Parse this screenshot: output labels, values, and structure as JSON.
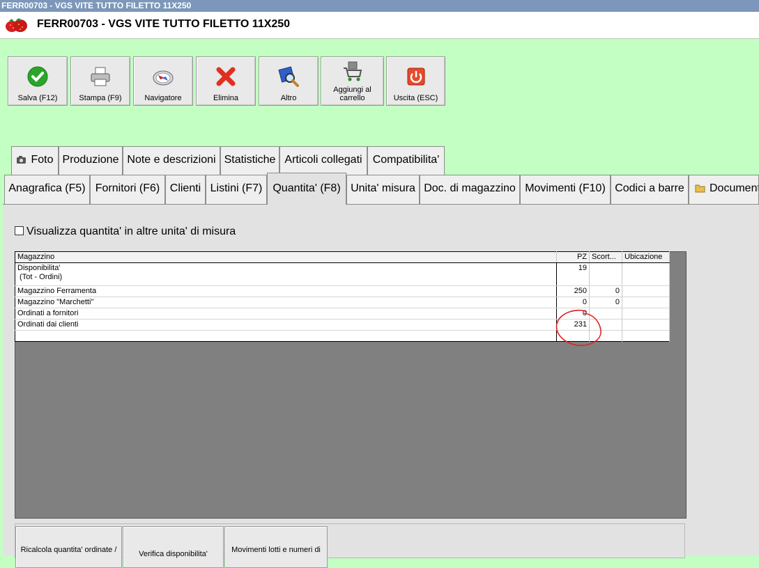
{
  "window": {
    "title": "FERR00703 - VGS VITE TUTTO FILETTO 11X250"
  },
  "header": {
    "title": "FERR00703 - VGS VITE TUTTO FILETTO 11X250",
    "logo": "strawberry-logo"
  },
  "toolbar": {
    "buttons": [
      {
        "label": "Salva (F12)",
        "icon": "check-icon"
      },
      {
        "label": "Stampa (F9)",
        "icon": "printer-icon"
      },
      {
        "label": "Navigatore",
        "icon": "compass-icon"
      },
      {
        "label": "Elimina",
        "icon": "delete-x-icon"
      },
      {
        "label": "Altro",
        "icon": "magnifier-icon"
      },
      {
        "label": "Aggiungi al carrello",
        "icon": "cart-icon"
      },
      {
        "label": "Uscita (ESC)",
        "icon": "power-icon"
      }
    ]
  },
  "tabs_row1": [
    "Foto",
    "Produzione",
    "Note e descrizioni",
    "Statistiche",
    "Articoli collegati",
    "Compatibilita'"
  ],
  "tabs_row2": [
    "Anagrafica (F5)",
    "Fornitori (F6)",
    "Clienti",
    "Listini (F7)",
    "Quantita' (F8)",
    "Unita' misura",
    "Doc. di magazzino",
    "Movimenti (F10)",
    "Codici a barre",
    "Document"
  ],
  "active_tab": "Quantita' (F8)",
  "checkbox": {
    "label": "Visualizza quantita' in altre unita' di misura",
    "checked": false
  },
  "table": {
    "columns": [
      "Magazzino",
      "PZ",
      "Scort...",
      "Ubicazione"
    ],
    "rows": [
      {
        "name_line1": "Disponibilita'",
        "name_line2": " (Tot - Ordini)",
        "pz": "19",
        "scorta": "",
        "ubicazione": ""
      },
      {
        "name_line1": "Magazzino Ferramenta",
        "pz": "250",
        "scorta": "0",
        "ubicazione": ""
      },
      {
        "name_line1": "Magazzino \"Marchetti\"",
        "pz": "0",
        "scorta": "0",
        "ubicazione": ""
      },
      {
        "name_line1": "Ordinati a fornitori",
        "pz": "0",
        "scorta": "",
        "ubicazione": ""
      },
      {
        "name_line1": "Ordinati dai clienti",
        "pz": "231",
        "scorta": "",
        "ubicazione": ""
      }
    ]
  },
  "bottom_buttons": [
    "Ricalcola quantita' ordinate /",
    "Verifica disponibilita'",
    "Movimenti lotti e numeri di"
  ],
  "colors": {
    "background": "#c3ffc3",
    "titlebar": "#7c97b9",
    "annotation": "#e02020"
  }
}
